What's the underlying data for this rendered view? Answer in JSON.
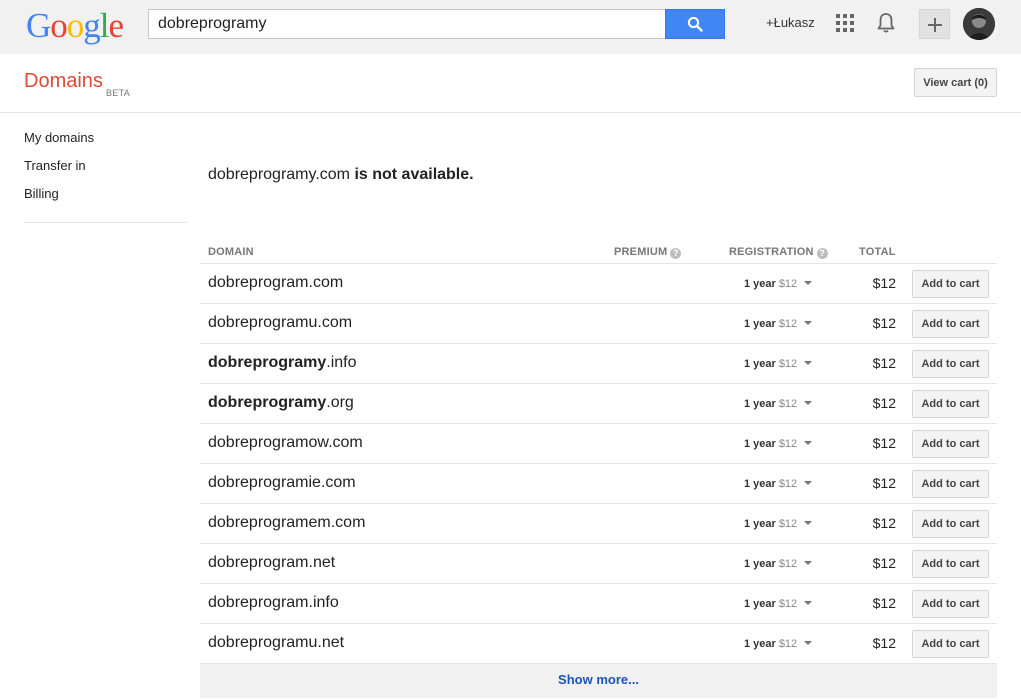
{
  "logo": {
    "letters": [
      {
        "ch": "G",
        "color": "#4285f4"
      },
      {
        "ch": "o",
        "color": "#ea4335"
      },
      {
        "ch": "o",
        "color": "#fbbc05"
      },
      {
        "ch": "g",
        "color": "#4285f4"
      },
      {
        "ch": "l",
        "color": "#34a853"
      },
      {
        "ch": "e",
        "color": "#ea4335"
      }
    ]
  },
  "search": {
    "value": "dobreprogramy",
    "button_icon": "search-icon"
  },
  "header": {
    "user_link": "+Łukasz",
    "apps_icon": "apps-grid-icon",
    "notifications_icon": "bell-icon",
    "share_icon": "plus-icon",
    "avatar_icon": "avatar"
  },
  "product": {
    "title": "Domains",
    "badge": "BETA",
    "view_cart": "View cart (0)"
  },
  "sidebar": {
    "items": [
      {
        "label": "My domains"
      },
      {
        "label": "Transfer in"
      },
      {
        "label": "Billing"
      }
    ]
  },
  "availability": {
    "domain": "dobreprogramy.com",
    "status": "is not available."
  },
  "table": {
    "headers": {
      "domain": "DOMAIN",
      "premium": "PREMIUM",
      "registration": "REGISTRATION",
      "total": "TOTAL"
    },
    "help_glyph": "?",
    "rows": [
      {
        "bold": "",
        "name": "dobreprogram.com",
        "period": "1 year",
        "price": "$12",
        "total": "$12",
        "action": "Add to cart"
      },
      {
        "bold": "",
        "name": "dobreprogramu.com",
        "period": "1 year",
        "price": "$12",
        "total": "$12",
        "action": "Add to cart"
      },
      {
        "bold": "dobreprogramy",
        "name": ".info",
        "period": "1 year",
        "price": "$12",
        "total": "$12",
        "action": "Add to cart"
      },
      {
        "bold": "dobreprogramy",
        "name": ".org",
        "period": "1 year",
        "price": "$12",
        "total": "$12",
        "action": "Add to cart"
      },
      {
        "bold": "",
        "name": "dobreprogramow.com",
        "period": "1 year",
        "price": "$12",
        "total": "$12",
        "action": "Add to cart"
      },
      {
        "bold": "",
        "name": "dobreprogramie.com",
        "period": "1 year",
        "price": "$12",
        "total": "$12",
        "action": "Add to cart"
      },
      {
        "bold": "",
        "name": "dobreprogramem.com",
        "period": "1 year",
        "price": "$12",
        "total": "$12",
        "action": "Add to cart"
      },
      {
        "bold": "",
        "name": "dobreprogram.net",
        "period": "1 year",
        "price": "$12",
        "total": "$12",
        "action": "Add to cart"
      },
      {
        "bold": "",
        "name": "dobreprogram.info",
        "period": "1 year",
        "price": "$12",
        "total": "$12",
        "action": "Add to cart"
      },
      {
        "bold": "",
        "name": "dobreprogramu.net",
        "period": "1 year",
        "price": "$12",
        "total": "$12",
        "action": "Add to cart"
      }
    ],
    "show_more": "Show more..."
  }
}
